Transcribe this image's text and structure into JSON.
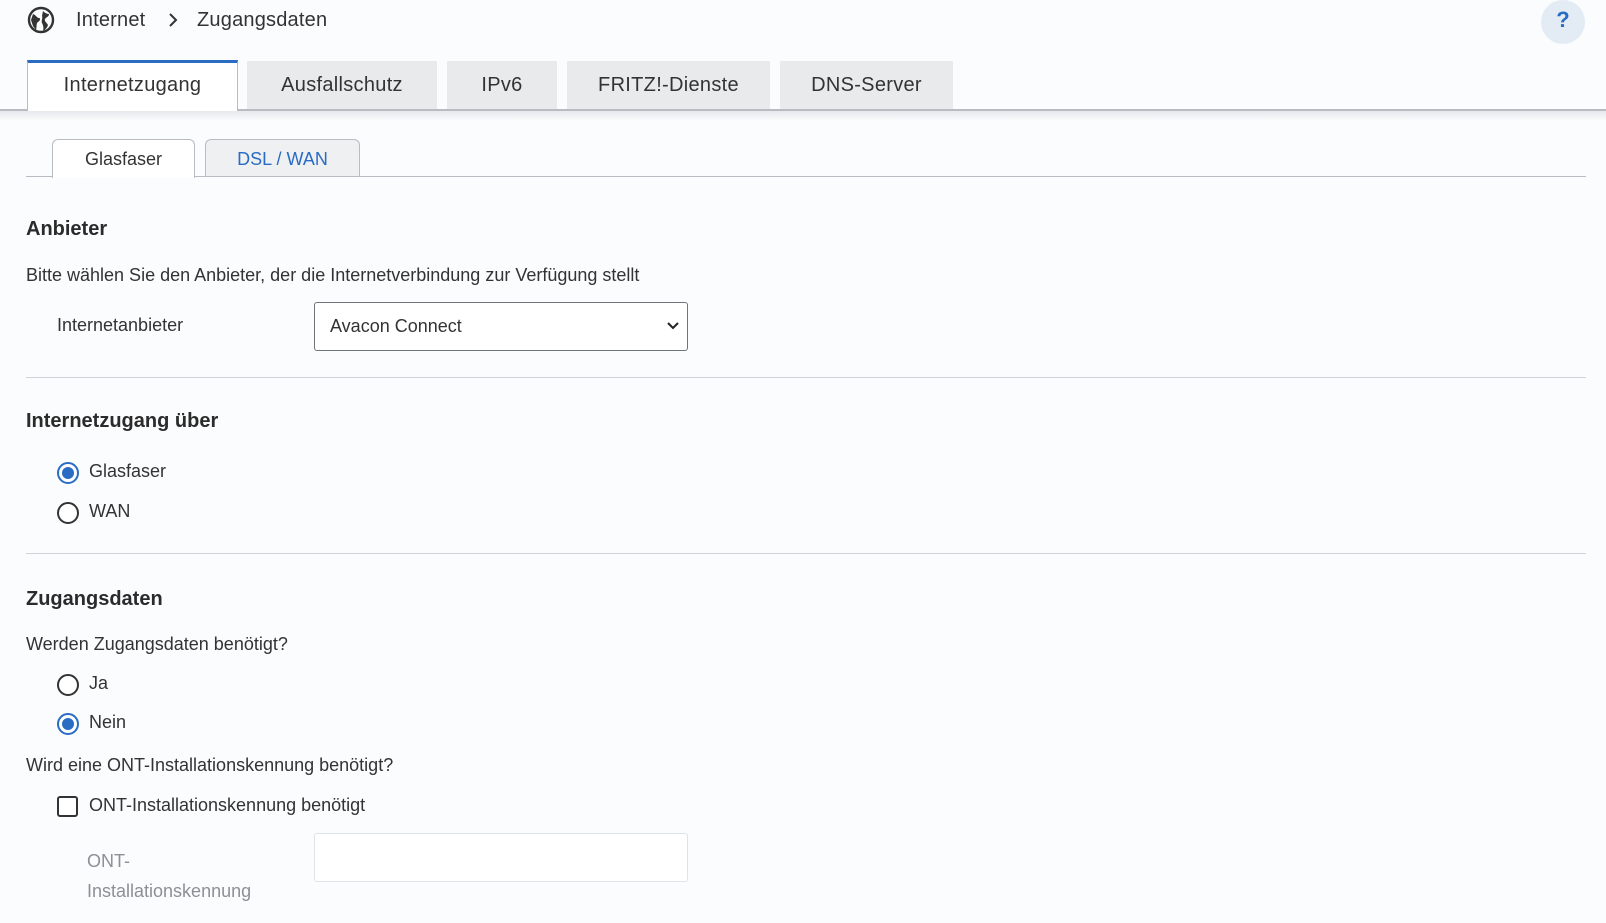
{
  "breadcrumb": {
    "icon": "globe-icon",
    "parent": "Internet",
    "current": "Zugangsdaten"
  },
  "help": {
    "label": "?"
  },
  "main_tabs": [
    {
      "label": "Internetzugang",
      "active": true
    },
    {
      "label": "Ausfallschutz",
      "active": false
    },
    {
      "label": "IPv6",
      "active": false
    },
    {
      "label": "FRITZ!-Dienste",
      "active": false
    },
    {
      "label": "DNS-Server",
      "active": false
    }
  ],
  "sub_tabs": [
    {
      "label": "Glasfaser",
      "active": true
    },
    {
      "label": "DSL / WAN",
      "active": false
    }
  ],
  "provider_section": {
    "heading": "Anbieter",
    "description": "Bitte wählen Sie den Anbieter, der die Internetverbindung zur Verfügung stellt",
    "field_label": "Internetanbieter",
    "selected": "Avacon Connect"
  },
  "access_section": {
    "heading": "Internetzugang über",
    "options": [
      {
        "label": "Glasfaser",
        "checked": true
      },
      {
        "label": "WAN",
        "checked": false
      }
    ]
  },
  "credentials_section": {
    "heading": "Zugangsdaten",
    "question": "Werden Zugangsdaten benötigt?",
    "options": [
      {
        "label": "Ja",
        "checked": false
      },
      {
        "label": "Nein",
        "checked": true
      }
    ],
    "ont_question": "Wird eine ONT-Installationskennung benötigt?",
    "ont_checkbox_label": "ONT-Installationskennung benötigt",
    "ont_checked": false,
    "ont_field_label_line1": "ONT-",
    "ont_field_label_line2": "Installationskennung",
    "ont_value": ""
  },
  "colors": {
    "accent": "#2a6cc4",
    "background": "#fbfcfd",
    "tab_inactive": "#e9eaec"
  }
}
